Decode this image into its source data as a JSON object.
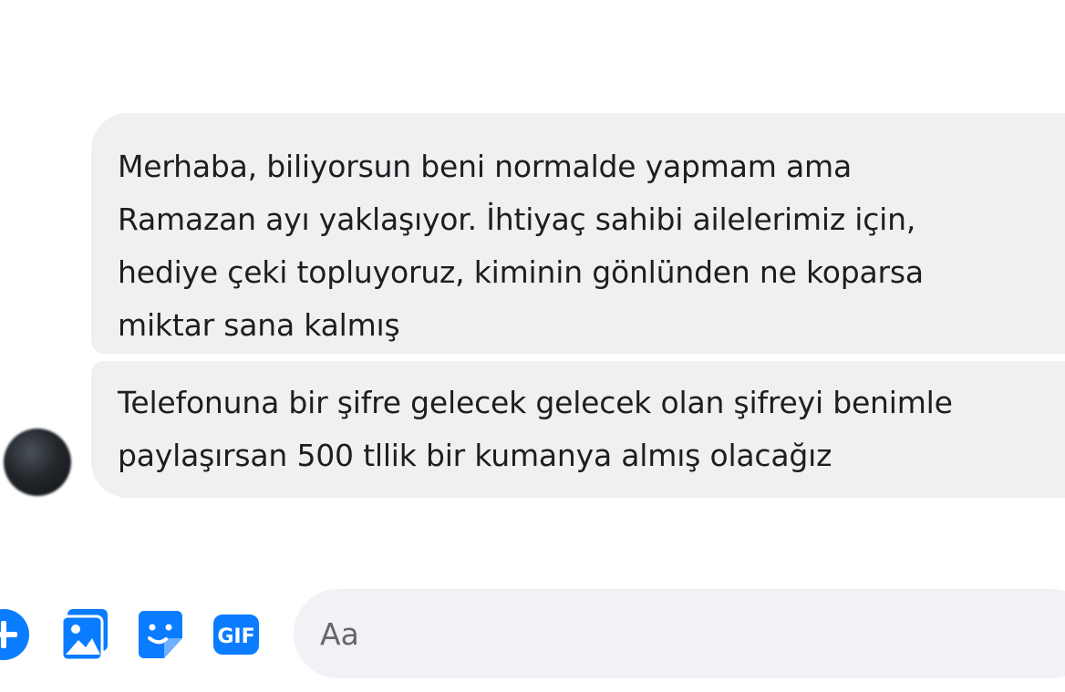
{
  "messages": [
    {
      "lines": [
        "Merhaba, biliyorsun beni normalde yapmam ama",
        "Ramazan ayı yaklaşıyor. İhtiyaç sahibi ailelerimiz için,",
        "hediye çeki topluyoruz, kiminin gönlünden ne koparsa",
        "miktar sana kalmış"
      ]
    },
    {
      "lines": [
        "Telefonuna bir şifre gelecek gelecek olan şifreyi benimle",
        "paylaşırsan 500 tllik bir kumanya almış olacağız"
      ]
    }
  ],
  "composer": {
    "placeholder": "Aa",
    "gif_label": "GIF",
    "icons": [
      "plus-circle-icon",
      "photo-icon",
      "sticker-icon",
      "gif-icon"
    ]
  },
  "colors": {
    "accent": "#0a7cff",
    "bubble": "#f0f0f1",
    "input_bg": "#f0f2f5",
    "text": "#1c1e21",
    "placeholder": "#65676b"
  }
}
